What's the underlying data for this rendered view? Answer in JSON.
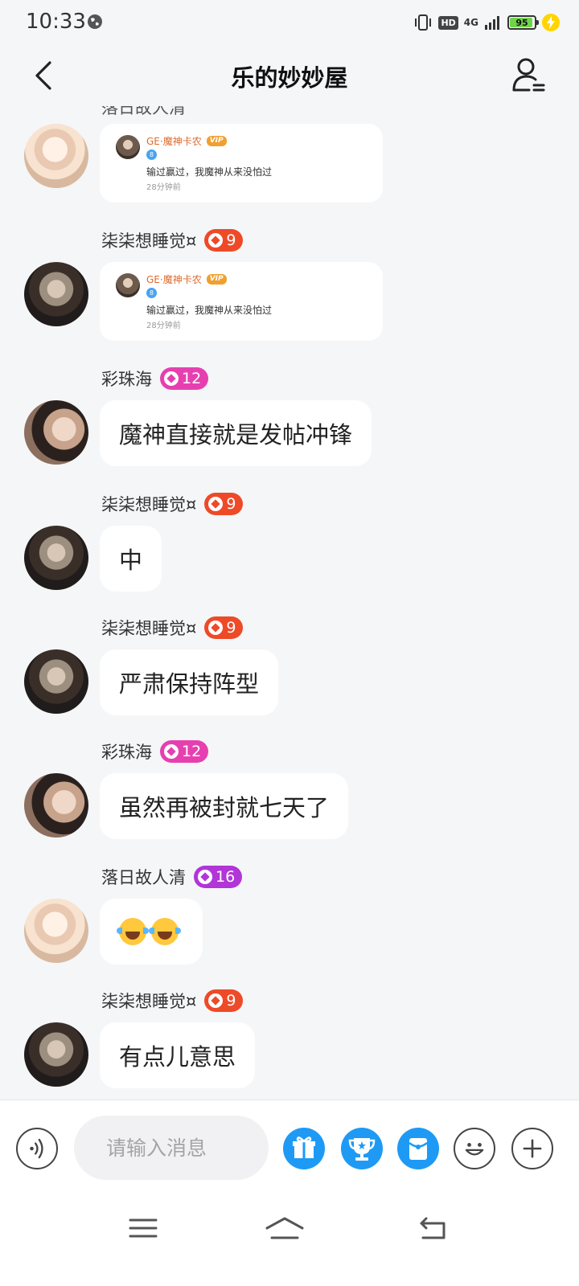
{
  "status_bar": {
    "time": "10:33",
    "network": "4G",
    "hd_label": "HD",
    "battery": "95",
    "battery_level": 0.95
  },
  "header": {
    "title": "乐的妙妙屋"
  },
  "messages": [
    {
      "type": "card",
      "avatar": "avatar-light",
      "card": {
        "name": "GE·魔神卡农",
        "vip": "VIP",
        "level": "8",
        "text": "输过赢过，我魔神从来没怕过",
        "time": "28分钟前"
      }
    },
    {
      "type": "card",
      "sender": "柒柒想睡觉¤",
      "badge": "9",
      "badge_color": "#ee4a28",
      "avatar": "avatar-dark",
      "card": {
        "name": "GE·魔神卡农",
        "vip": "VIP",
        "level": "8",
        "text": "输过赢过，我魔神从来没怕过",
        "time": "28分钟前"
      }
    },
    {
      "type": "text",
      "sender": "彩珠海",
      "badge": "12",
      "badge_color": "#e640b0",
      "avatar": "avatar-girl",
      "text": "魔神直接就是发帖冲锋"
    },
    {
      "type": "text",
      "sender": "柒柒想睡觉¤",
      "badge": "9",
      "badge_color": "#ee4a28",
      "avatar": "avatar-dark",
      "text": "中"
    },
    {
      "type": "text",
      "sender": "柒柒想睡觉¤",
      "badge": "9",
      "badge_color": "#ee4a28",
      "avatar": "avatar-dark",
      "text": "严肃保持阵型"
    },
    {
      "type": "text",
      "sender": "彩珠海",
      "badge": "12",
      "badge_color": "#e640b0",
      "avatar": "avatar-girl",
      "text": "虽然再被封就七天了"
    },
    {
      "type": "emoji",
      "sender": "落日故人清",
      "badge": "16",
      "badge_color": "#b235d8",
      "avatar": "avatar-light",
      "emoji": "tears-of-joy-emoji x2"
    },
    {
      "type": "text",
      "sender": "柒柒想睡觉¤",
      "badge": "9",
      "badge_color": "#ee4a28",
      "avatar": "avatar-dark",
      "text": "有点儿意思"
    }
  ],
  "input_bar": {
    "placeholder": "请输入消息",
    "buttons": [
      "voice-icon",
      "gift-icon",
      "trophy-icon",
      "envelope-icon",
      "emoji-icon",
      "plus-icon"
    ]
  },
  "nav_bar": {
    "buttons": [
      "menu-icon",
      "home-icon",
      "back-icon"
    ]
  },
  "colors": {
    "accent_blue": "#1e9af5",
    "background": "#f5f6f8"
  }
}
